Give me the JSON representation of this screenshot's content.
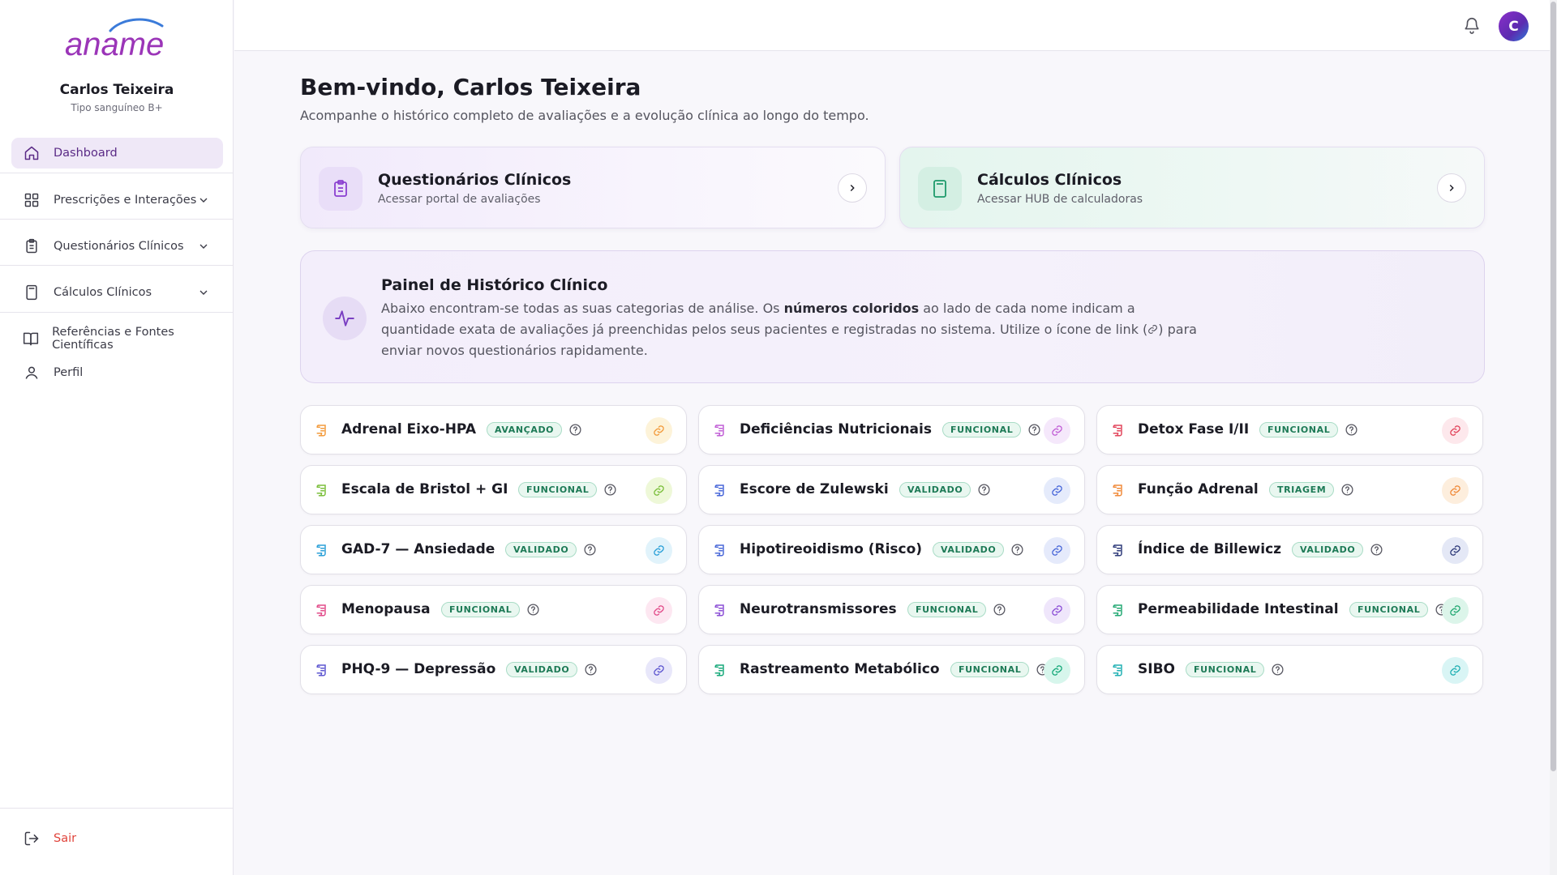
{
  "brand": {
    "logo_text": "aname"
  },
  "user": {
    "name": "Carlos Teixeira",
    "blood_type": "Tipo sanguíneo B+",
    "avatar_initial": "C"
  },
  "sidebar": {
    "items": [
      {
        "label": "Dashboard",
        "icon": "home-icon",
        "active": true
      },
      {
        "label": "Prescrições e Interações",
        "icon": "grid-icon",
        "expandable": true
      },
      {
        "label": "Questionários Clínicos",
        "icon": "clipboard-icon",
        "expandable": true
      },
      {
        "label": "Cálculos Clínicos",
        "icon": "calculator-icon",
        "expandable": true
      },
      {
        "label": "Referências e Fontes Científicas",
        "icon": "book-icon"
      },
      {
        "label": "Perfil",
        "icon": "user-icon"
      }
    ],
    "logout_label": "Sair"
  },
  "main": {
    "title": "Bem-vindo, Carlos Teixeira",
    "subtitle": "Acompanhe o histórico completo de avaliações e a evolução clínica ao longo do tempo.",
    "shortcuts": [
      {
        "title": "Questionários Clínicos",
        "subtitle": "Acessar portal de avaliações"
      },
      {
        "title": "Cálculos Clínicos",
        "subtitle": "Acessar HUB de calculadoras"
      }
    ],
    "panel": {
      "title": "Painel de Histórico Clínico",
      "text_1": "Abaixo encontram-se todas as suas categorias de análise. Os ",
      "text_bold": "números coloridos",
      "text_2": " ao lado de cada nome indicam a quantidade exata de avaliações já preenchidas pelos seus pacientes e registradas no sistema. Utilize o ícone de link (",
      "text_3": ") para enviar novos questionários rapidamente."
    },
    "questionnaires": [
      {
        "name": "Adrenal Eixo-HPA",
        "badge": "AVANÇADO",
        "color": "#f39b3d",
        "link_bg": "#fdf3d9"
      },
      {
        "name": "Deficiências Nutricionais",
        "badge": "FUNCIONAL",
        "color": "#c15fd6",
        "link_bg": "#f5e8fb"
      },
      {
        "name": "Detox Fase I/II",
        "badge": "FUNCIONAL",
        "color": "#e2455b",
        "link_bg": "#fde8ec"
      },
      {
        "name": "Escala de Bristol + GI",
        "badge": "FUNCIONAL",
        "color": "#7bbf3b",
        "link_bg": "#eef8d8"
      },
      {
        "name": "Escore de Zulewski",
        "badge": "VALIDADO",
        "color": "#4867d9",
        "link_bg": "#e5ebfb"
      },
      {
        "name": "Função Adrenal",
        "badge": "TRIAGEM",
        "color": "#f08a3a",
        "link_bg": "#fdeedd"
      },
      {
        "name": "GAD-7 — Ansiedade",
        "badge": "VALIDADO",
        "color": "#2ba0d8",
        "link_bg": "#e1f3fb"
      },
      {
        "name": "Hipotireoidismo (Risco)",
        "badge": "VALIDADO",
        "color": "#4a68d8",
        "link_bg": "#e5eafb"
      },
      {
        "name": "Índice de Billewicz",
        "badge": "VALIDADO",
        "color": "#2f3b7a",
        "link_bg": "#e4e8f6"
      },
      {
        "name": "Menopausa",
        "badge": "FUNCIONAL",
        "color": "#e24c8a",
        "link_bg": "#fde7f1"
      },
      {
        "name": "Neurotransmissores",
        "badge": "FUNCIONAL",
        "color": "#8b4fd6",
        "link_bg": "#efe6fb"
      },
      {
        "name": "Permeabilidade Intestinal",
        "badge": "FUNCIONAL",
        "color": "#23a873",
        "link_bg": "#dcf5ea"
      },
      {
        "name": "PHQ-9 — Depressão",
        "badge": "VALIDADO",
        "color": "#5e57d0",
        "link_bg": "#e8e7fa"
      },
      {
        "name": "Rastreamento Metabólico",
        "badge": "FUNCIONAL",
        "color": "#17a97a",
        "link_bg": "#d7f6ec"
      },
      {
        "name": "SIBO",
        "badge": "FUNCIONAL",
        "color": "#21b0b3",
        "link_bg": "#d9f5f5"
      }
    ]
  }
}
